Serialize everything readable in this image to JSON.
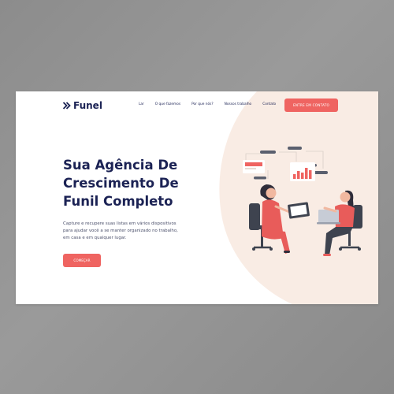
{
  "brand": {
    "name": "Funel",
    "accent": "#ef6461",
    "navy": "#1b2254"
  },
  "nav": {
    "items": [
      "Lar",
      "O que fazemos",
      "Por que nós?",
      "Nossos trabalho",
      "Contato"
    ]
  },
  "header": {
    "cta_label": "ENTRE EM CONTATO"
  },
  "hero": {
    "title_lines": [
      "Sua Agência De",
      "Crescimento De",
      "Funil Completo"
    ],
    "description_lines": [
      "Capture e recupere suas listas em vários dispositivos",
      "para ajudar você a se manter organizado no trabalho,",
      "em casa e em qualquer lugar."
    ],
    "cta_label": "COMEÇAR"
  },
  "illustration": {
    "icon": "two-women-working-illustration"
  }
}
